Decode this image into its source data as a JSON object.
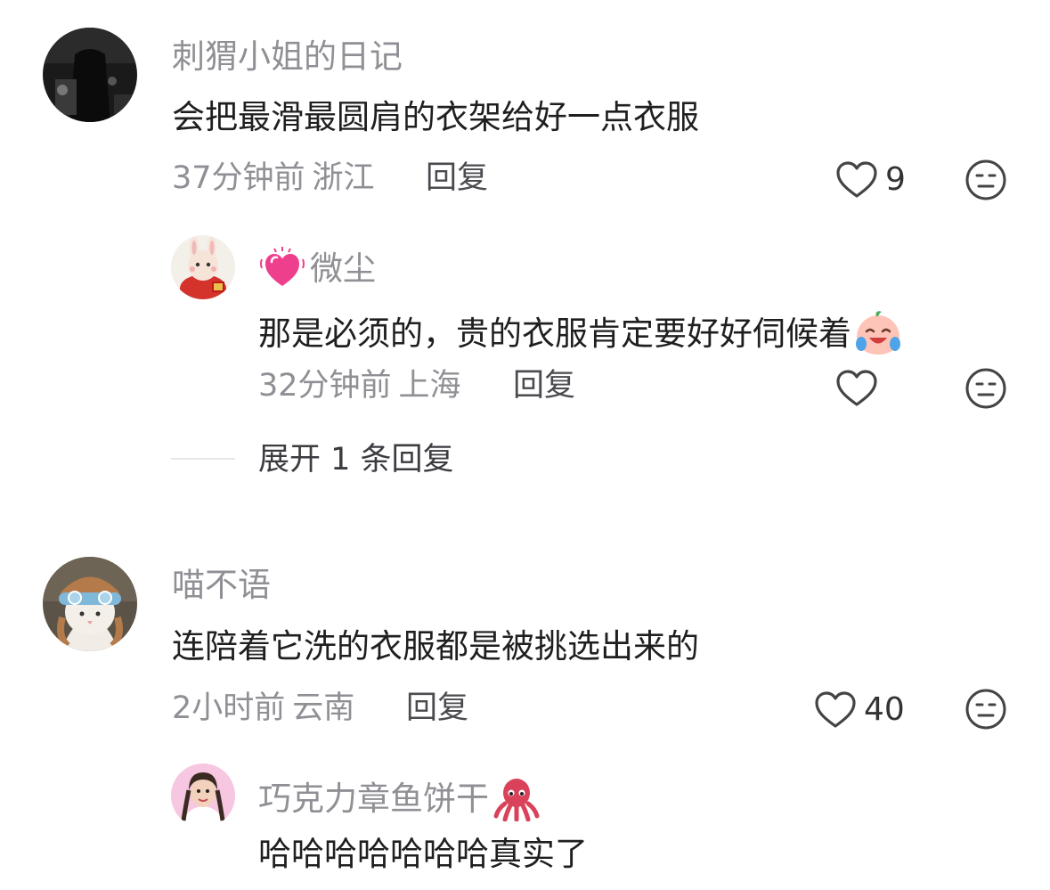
{
  "comments": [
    {
      "username": "刺猬小姐的日记",
      "content": "会把最滑最圆肩的衣架给好一点衣服",
      "time": "37分钟前",
      "location": "浙江",
      "reply_label": "回复",
      "likes": "9",
      "replies": [
        {
          "username": "微尘",
          "username_prefix_emoji": "sparkling-heart",
          "content": "那是必须的，贵的衣服肯定要好好伺候着",
          "content_suffix_emoji": "crying-laughing-peach",
          "time": "32分钟前",
          "location": "上海",
          "reply_label": "回复",
          "likes": ""
        }
      ],
      "expand_label": "展开 1 条回复"
    },
    {
      "username": "喵不语",
      "content": "连陪着它洗的衣服都是被挑选出来的",
      "time": "2小时前",
      "location": "云南",
      "reply_label": "回复",
      "likes": "40",
      "replies": [
        {
          "username": "巧克力章鱼饼干",
          "username_suffix_emoji": "octopus",
          "content": "哈哈哈哈哈哈哈真实了"
        }
      ]
    }
  ],
  "colors": {
    "username": "#8f8f95",
    "content": "#1f1f1f",
    "meta": "#8f8f95",
    "heart": "#e8407a"
  }
}
